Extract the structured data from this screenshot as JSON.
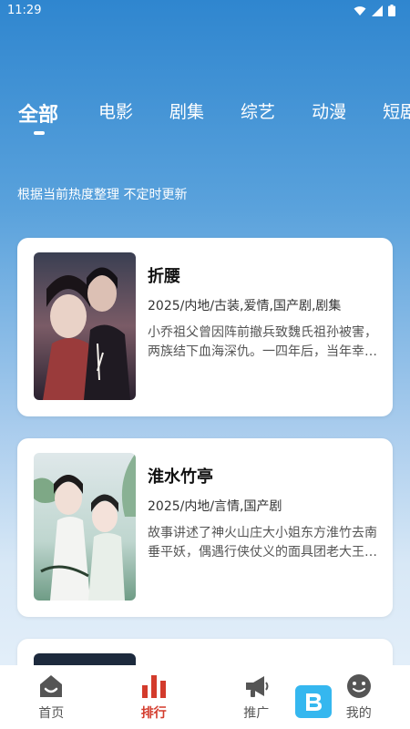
{
  "status": {
    "time": "11:29"
  },
  "tabs": [
    {
      "label": "全部"
    },
    {
      "label": "电影"
    },
    {
      "label": "剧集"
    },
    {
      "label": "综艺"
    },
    {
      "label": "动漫"
    },
    {
      "label": "短剧"
    }
  ],
  "subtitle": "根据当前热度整理 不定时更新",
  "cards": [
    {
      "title": "折腰",
      "meta": "2025/内地/古装,爱情,国产剧,剧集",
      "desc": "小乔祖父曾因阵前撤兵致魏氏祖孙被害，两族结下血海深仇。一四年后，当年幸存的魏劭率军剑指兖州，表面..."
    },
    {
      "title": "淮水竹亭",
      "meta": "2025/内地/言情,国产剧",
      "desc": "故事讲述了神火山庄大小姐东方淮竹去南垂平妖，偶遇行侠仗义的面具团老大王权弘业，两人深入南垂腹地，..."
    }
  ],
  "nav": [
    {
      "label": "首页",
      "icon": "home-icon"
    },
    {
      "label": "排行",
      "icon": "ranking-icon"
    },
    {
      "label": "推广",
      "icon": "megaphone-icon"
    },
    {
      "label": "我的",
      "icon": "profile-icon"
    }
  ],
  "colors": {
    "accent": "#d33b2c",
    "header_blue": "#2f86cf"
  }
}
